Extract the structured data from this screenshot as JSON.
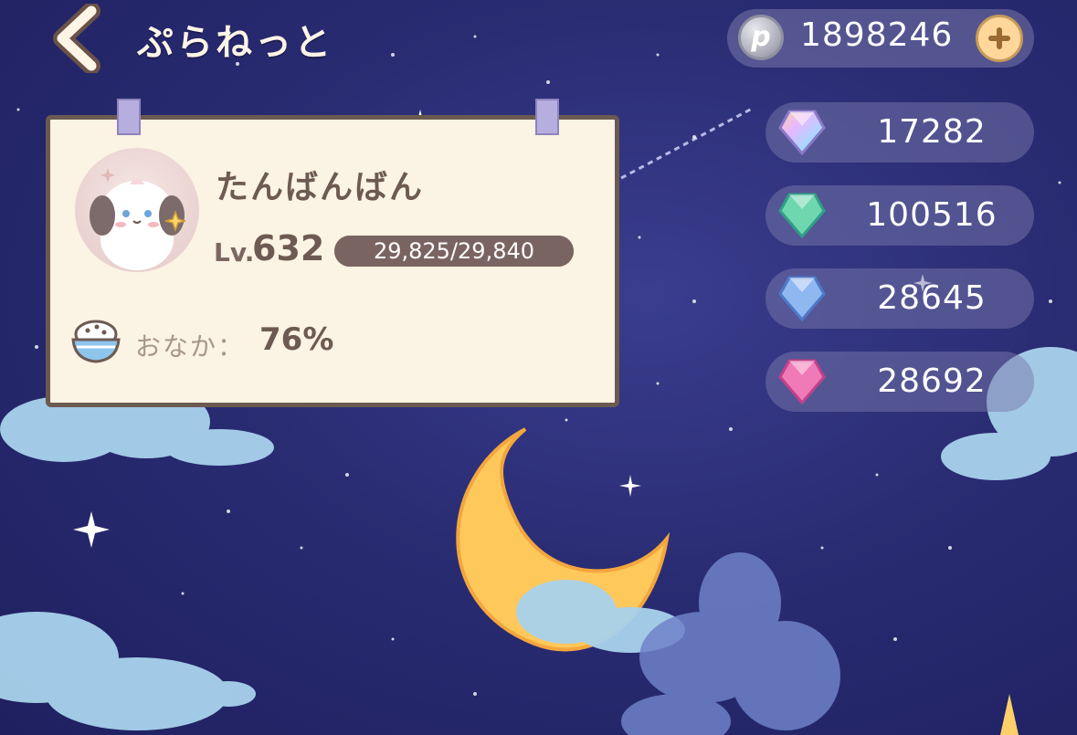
{
  "header": {
    "title": "ぷらねっと",
    "back_icon": "chevron-left-icon"
  },
  "currency": {
    "coin_symbol": "p",
    "coin_value": "1898246",
    "add_icon": "plus-icon"
  },
  "gems": [
    {
      "name": "rainbow-gem-icon",
      "color": "#c9b8f0",
      "value": "17282"
    },
    {
      "name": "green-gem-icon",
      "color": "#6ed7b0",
      "value": "100516"
    },
    {
      "name": "blue-gem-icon",
      "color": "#8fb7f0",
      "value": "28645"
    },
    {
      "name": "pink-gem-icon",
      "color": "#f07ab8",
      "value": "28692"
    }
  ],
  "profile": {
    "name": "たんばんばん",
    "level_prefix": "Lv.",
    "level": "632",
    "exp_text": "29,825/29,840",
    "exp_fraction": 0.9995,
    "hunger_label": "おなか：",
    "hunger_value": "76%"
  },
  "colors": {
    "sky": "#2a2c73",
    "card_bg": "#fbf3e3",
    "card_border": "#6b5a50",
    "moon": "#ffc85a"
  }
}
